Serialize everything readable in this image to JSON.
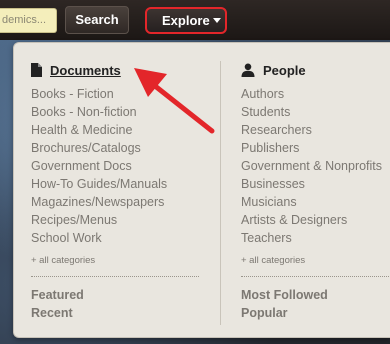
{
  "header": {
    "search_value": "demics...",
    "search_button": "Search",
    "explore_button": "Explore"
  },
  "dropdown": {
    "left": {
      "title": "Documents",
      "icon": "document-icon",
      "items": [
        "Books - Fiction",
        "Books - Non-fiction",
        "Health & Medicine",
        "Brochures/Catalogs",
        "Government Docs",
        "How-To Guides/Manuals",
        "Magazines/Newspapers",
        "Recipes/Menus",
        "School Work"
      ],
      "all_categories": "+ all categories",
      "footer": [
        "Featured",
        "Recent"
      ]
    },
    "right": {
      "title": "People",
      "icon": "person-icon",
      "items": [
        "Authors",
        "Students",
        "Researchers",
        "Publishers",
        "Government & Nonprofits",
        "Businesses",
        "Musicians",
        "Artists & Designers",
        "Teachers"
      ],
      "all_categories": "+ all categories",
      "footer": [
        "Most Followed",
        "Popular"
      ]
    }
  },
  "colors": {
    "accent_red": "#e3262a",
    "panel_bg": "#e9e6df",
    "muted_text": "#7c7872"
  }
}
